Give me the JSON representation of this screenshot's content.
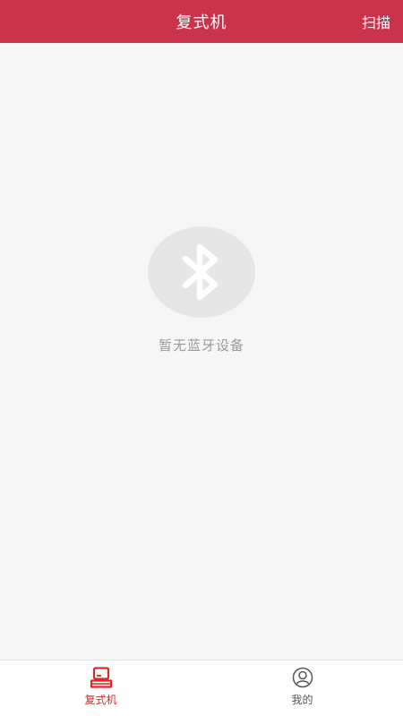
{
  "header": {
    "title": "复式机",
    "action_label": "扫描"
  },
  "empty_state": {
    "icon": "bluetooth-icon",
    "message": "暂无蓝牙设备"
  },
  "tabbar": {
    "items": [
      {
        "label": "复式机",
        "icon": "printer-icon",
        "active": true
      },
      {
        "label": "我的",
        "icon": "user-icon",
        "active": false
      }
    ]
  },
  "colors": {
    "header_bg": "#c9344c",
    "accent": "#e02727",
    "page_bg": "#f6f6f6",
    "empty_circle": "#e6e6e6"
  }
}
